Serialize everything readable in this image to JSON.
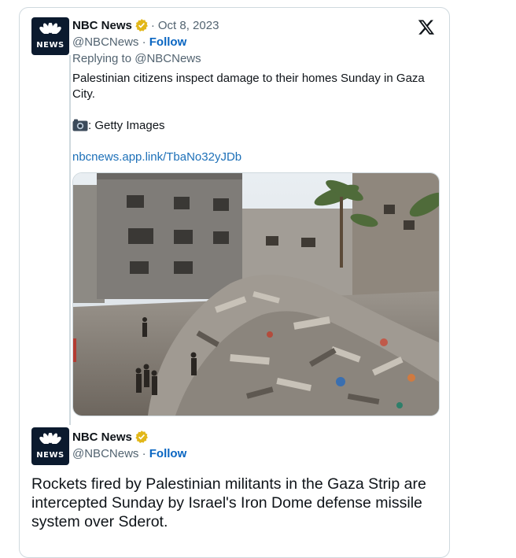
{
  "tweet1": {
    "name": "NBC News",
    "separator": "·",
    "date": "Oct 8, 2023",
    "handle": "@NBCNews",
    "handle_sep": " · ",
    "follow": "Follow",
    "replying": "Replying to @NBCNews",
    "text_line1": "Palestinian citizens inspect damage to their homes Sunday in Gaza City.",
    "credit": ": Getty Images",
    "link": "nbcnews.app.link/TbaNo32yJDb",
    "photo_icon": "camera-icon"
  },
  "tweet2": {
    "name": "NBC News",
    "handle": "@NBCNews",
    "handle_sep": " · ",
    "follow": "Follow",
    "text": "Rockets fired by Palestinian militants in the Gaza Strip are intercepted Sunday by Israel's Iron Dome defense missile system over Sderot."
  },
  "avatar": {
    "label": "NEWS",
    "icon": "peacock-logo-icon"
  },
  "platform_icon": "x-logo-icon",
  "colors": {
    "link": "#1d70b8",
    "follow": "#0a66c2",
    "verified": "#e2b719",
    "secondary": "#536471",
    "border": "#cfd9de"
  }
}
